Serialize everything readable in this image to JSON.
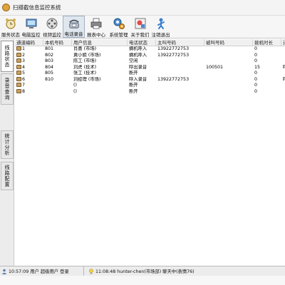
{
  "window": {
    "title": "扫描截信息监控系统"
  },
  "toolbar": {
    "buttons": [
      {
        "label": "服务状态",
        "icon": "alarm-clock-icon"
      },
      {
        "label": "电脑监控",
        "icon": "monitor-icon"
      },
      {
        "label": "视频监控",
        "icon": "camera-film-icon"
      },
      {
        "label": "电话录音",
        "icon": "telephone-icon"
      },
      {
        "label": "报表中心",
        "icon": "printer-icon"
      },
      {
        "label": "系统管理",
        "icon": "gear-icon"
      },
      {
        "label": "关于我们",
        "icon": "about-icon"
      },
      {
        "label": "注销退出",
        "icon": "exit-person-icon"
      }
    ]
  },
  "sidebar": {
    "tabs": [
      {
        "label": "线路状态"
      },
      {
        "label": "录音查询"
      },
      {
        "label": "统计分析"
      },
      {
        "label": "线路配置"
      }
    ]
  },
  "table": {
    "columns": [
      "通道编码",
      "本机号码",
      "用户信息",
      "电话状态",
      "主叫号码",
      "被叫号码",
      "拨机时长",
      "通"
    ],
    "rows": [
      {
        "channel": "1",
        "local": "801",
        "user": "肖喜 (市场)",
        "status": "摘机呼入",
        "caller": "13922772753",
        "callee": "",
        "duration": "0",
        "extra": ""
      },
      {
        "channel": "2",
        "local": "802",
        "user": "黄小姐 (市场)",
        "status": "摘机呼入",
        "caller": "13922772753",
        "callee": "",
        "duration": "0",
        "extra": ""
      },
      {
        "channel": "3",
        "local": "803",
        "user": "陈工 (市场)",
        "status": "空闲",
        "caller": "",
        "callee": "",
        "duration": "0",
        "extra": ""
      },
      {
        "channel": "4",
        "local": "804",
        "user": "刘虎 (技术)",
        "status": "呼出录音",
        "caller": "",
        "callee": "100501",
        "duration": "15",
        "extra": "呼"
      },
      {
        "channel": "5",
        "local": "805",
        "user": "张工 (技术)",
        "status": "断开",
        "caller": "",
        "callee": "",
        "duration": "0",
        "extra": ""
      },
      {
        "channel": "6",
        "local": "810",
        "user": "刘经理 (市场)",
        "status": "呼入录音",
        "caller": "13922772753",
        "callee": "",
        "duration": "0",
        "extra": "呼"
      },
      {
        "channel": "7",
        "local": "",
        "user": "()",
        "status": "断开",
        "caller": "",
        "callee": "",
        "duration": "0",
        "extra": ""
      },
      {
        "channel": "8",
        "local": "",
        "user": "()",
        "status": "断开",
        "caller": "",
        "callee": "",
        "duration": "0",
        "extra": ""
      }
    ]
  },
  "statusbar": {
    "left_text": "10:57:09 用户 超级用户 登录",
    "right_text": "11:08:48 hunter-chen(市场部) 聊天中(表情76)"
  },
  "colors": {
    "accent": "#dfe6ee",
    "row_icon": "#c8a060"
  }
}
